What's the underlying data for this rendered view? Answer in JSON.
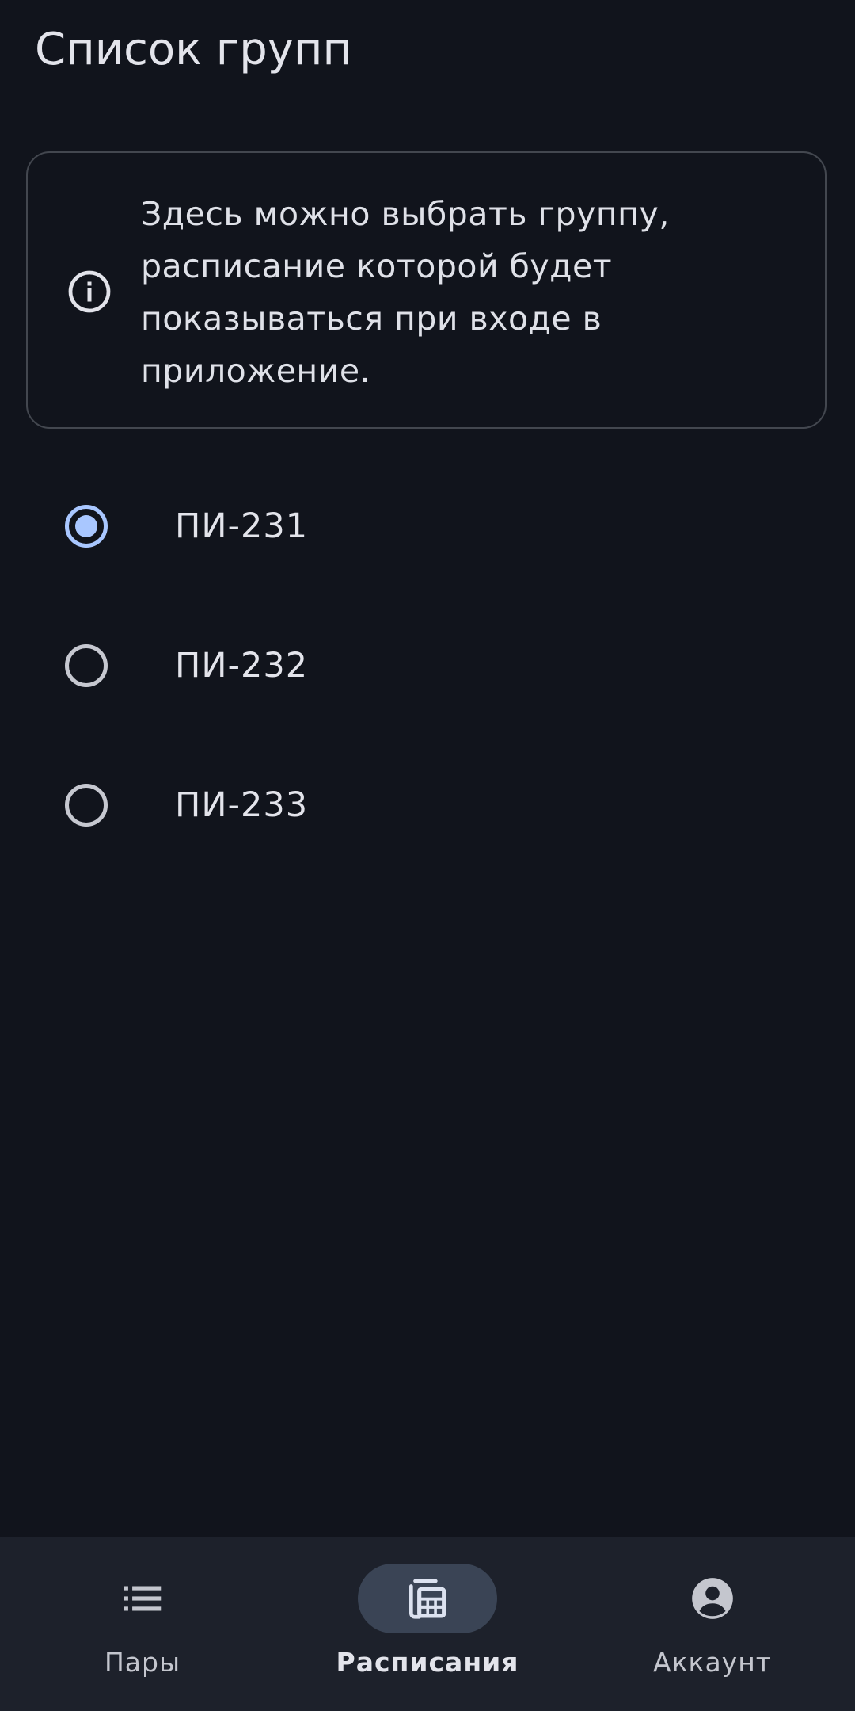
{
  "header": {
    "title": "Список групп"
  },
  "info_card": {
    "icon": "info-icon",
    "text": "Здесь можно выбрать группу, расписание которой будет показываться при входе в приложение."
  },
  "groups": {
    "selected": "ПИ-231",
    "items": [
      {
        "label": "ПИ-231",
        "checked": true
      },
      {
        "label": "ПИ-232",
        "checked": false
      },
      {
        "label": "ПИ-233",
        "checked": false
      }
    ]
  },
  "bottom_nav": {
    "items": [
      {
        "label": "Пары",
        "icon": "list-icon",
        "active": false
      },
      {
        "label": "Расписания",
        "icon": "calendar-icon",
        "active": true
      },
      {
        "label": "Аккаунт",
        "icon": "account-circle-icon",
        "active": false
      }
    ]
  },
  "colors": {
    "background": "#11141c",
    "accent": "#a9c7ff",
    "nav_background": "#1d212b",
    "nav_active_pill": "#3a4455"
  }
}
